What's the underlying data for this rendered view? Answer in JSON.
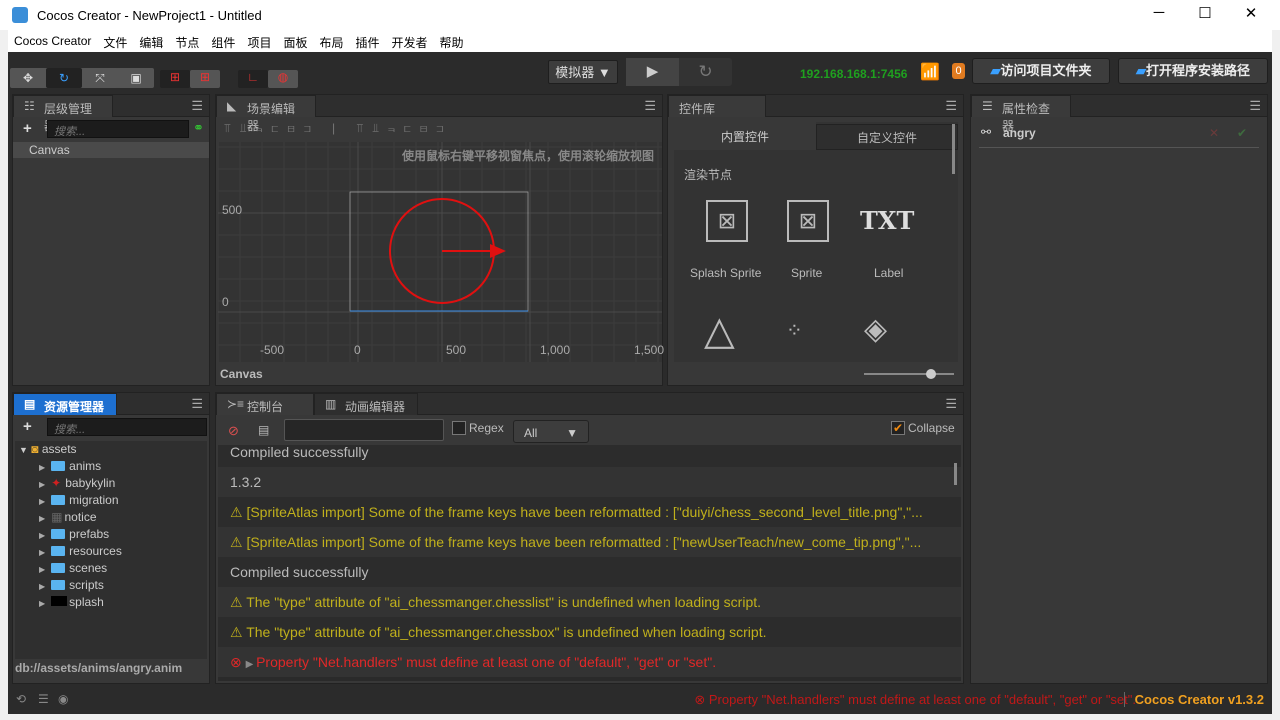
{
  "window": {
    "title": "Cocos Creator - NewProject1 - Untitled",
    "minimize": "─",
    "maximize": "☐",
    "close": "✕"
  },
  "menu": [
    "Cocos Creator",
    "文件",
    "编辑",
    "节点",
    "组件",
    "项目",
    "面板",
    "布局",
    "插件",
    "开发者",
    "帮助"
  ],
  "toolbar": {
    "platform": "模拟器",
    "ip": "192.168.168.1:7456",
    "badge": "0",
    "open_project": "访问项目文件夹",
    "open_install": "打开程序安装路径",
    "play": "▶",
    "refresh": "↻"
  },
  "hierarchy": {
    "title": "层级管理器",
    "search_placeholder": "搜索...",
    "nodes": [
      "Canvas"
    ]
  },
  "scene": {
    "title": "场景编辑器",
    "hint": "使用鼠标右键平移视窗焦点，使用滚轮缩放视图",
    "y_labels": [
      "500",
      "0"
    ],
    "x_labels": [
      "-500",
      "0",
      "500",
      "1,000",
      "1,500"
    ],
    "footer": "Canvas"
  },
  "widgets": {
    "title": "控件库",
    "tabs": [
      "内置控件",
      "自定义控件"
    ],
    "section": "渲染节点",
    "items": [
      "Splash Sprite",
      "Sprite",
      "Label"
    ],
    "label_glyph": "TXT"
  },
  "inspector": {
    "title": "属性检查器",
    "node": "angry"
  },
  "assets": {
    "title": "资源管理器",
    "search_placeholder": "搜索...",
    "root": "assets",
    "children": [
      "anims",
      "babykylin",
      "migration",
      "notice",
      "prefabs",
      "resources",
      "scenes",
      "scripts",
      "splash"
    ],
    "path": "db://assets/anims/angry.anim"
  },
  "console": {
    "tabs": [
      "控制台",
      "动画编辑器"
    ],
    "regex": "Regex",
    "filter": "All",
    "collapse": "Collapse",
    "logs": [
      {
        "type": "ok",
        "text": "Compiled successfully"
      },
      {
        "type": "ok",
        "text": "1.3.2"
      },
      {
        "type": "warn",
        "text": "[SpriteAtlas import] Some of the frame keys have been reformatted : [\"duiyi/chess_second_level_title.png\",\"..."
      },
      {
        "type": "warn",
        "text": "[SpriteAtlas import] Some of the frame keys have been reformatted : [\"newUserTeach/new_come_tip.png\",\"..."
      },
      {
        "type": "ok",
        "text": "Compiled successfully"
      },
      {
        "type": "warn",
        "text": "The \"type\" attribute of \"ai_chessmanger.chesslist\" is undefined when loading script."
      },
      {
        "type": "warn",
        "text": "The \"type\" attribute of \"ai_chessmanger.chessbox\" is undefined when loading script."
      },
      {
        "type": "err",
        "text": "Property \"Net.handlers\" must define at least one of \"default\", \"get\" or \"set\"."
      }
    ]
  },
  "status": {
    "message": "Property \"Net.handlers\" must define at least one of \"default\", \"get\" or \"set\".",
    "version": "Cocos Creator v1.3.2"
  },
  "colors": {
    "accent": "#1d6fd0",
    "ip": "#1fa01f",
    "warn": "#c0b01c",
    "error": "#e02828",
    "version": "#f0a020"
  }
}
